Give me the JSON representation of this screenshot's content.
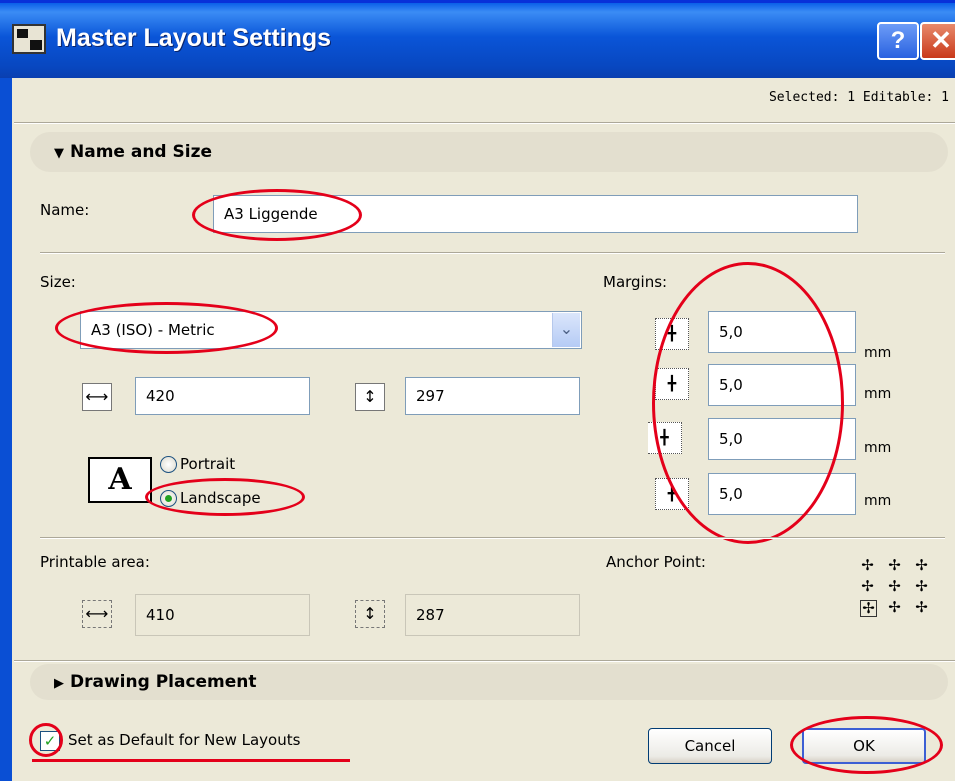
{
  "window": {
    "title": "Master Layout Settings",
    "help_glyph": "?",
    "close_glyph": "✕"
  },
  "selected_info": "Selected: 1 Editable: 1",
  "name_and_size": {
    "header": "Name and Size",
    "name_label": "Name:",
    "name_value": "A3 Liggende",
    "size_label": "Size:",
    "size_value": "A3 (ISO) - Metric",
    "width_value": "420",
    "height_value": "297",
    "orientation_icon_glyph": "A",
    "portrait_label": "Portrait",
    "landscape_label": "Landscape",
    "orientation_selected": "Landscape",
    "margins_label": "Margins:",
    "margins": [
      {
        "value": "5,0",
        "unit": "mm",
        "icon": "margin-top-icon"
      },
      {
        "value": "5,0",
        "unit": "mm",
        "icon": "margin-bottom-icon"
      },
      {
        "value": "5,0",
        "unit": "mm",
        "icon": "margin-left-icon"
      },
      {
        "value": "5,0",
        "unit": "mm",
        "icon": "margin-right-icon"
      }
    ],
    "printable_area_label": "Printable area:",
    "printable_width": "410",
    "printable_height": "287",
    "anchor_point_label": "Anchor Point:",
    "anchor_selected": "bottom-left"
  },
  "drawing_placement": {
    "header": "Drawing Placement"
  },
  "footer": {
    "default_checkbox_label": "Set as Default for New Layouts",
    "default_checked": true,
    "cancel_label": "Cancel",
    "ok_label": "OK"
  },
  "colors": {
    "titlebar": "#0a55d8",
    "dialog_bg": "#ece9d8",
    "highlight_ellipse": "#e4001a"
  }
}
